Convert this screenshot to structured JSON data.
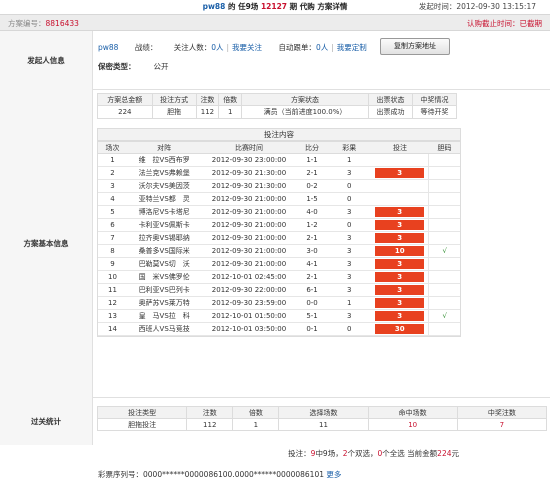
{
  "header": {
    "username": "pw88",
    "title_mid1": "的",
    "lottery": "任9场",
    "issue": "12127",
    "title_tail": "期 代购 方案详情",
    "launch_time_label": "发起时间：",
    "launch_time": "2012-09-30 13:15:17"
  },
  "id_bar": {
    "label": "方案编号：",
    "value": "8816433",
    "buy_label": "认购截止时间：",
    "buy_value": "已截期"
  },
  "initiator": {
    "section_label": "发起人信息",
    "username": "pw88",
    "record_label": "战绩：",
    "follow_label": "关注人数：",
    "follow_count": "0人",
    "follow_link": "我要关注",
    "custom_label": "自动跟单：",
    "custom_count": "0人",
    "custom_link": "我要定制",
    "copy_button": "复制方案地址",
    "privacy_label": "保密类型：",
    "privacy_value": "公开"
  },
  "scheme": {
    "section_label": "方案基本信息",
    "summary_headers": [
      "方案总金额",
      "投注方式",
      "注数",
      "倍数",
      "方案状态",
      "出票状态",
      "中奖情况"
    ],
    "summary_values": [
      "224",
      "胆拖",
      "112",
      "1",
      "满员（当前进度100.0%）",
      "出票成功",
      "等待开奖"
    ],
    "content_title": "投注内容",
    "match_headers": [
      "场次",
      "对阵",
      "比赛时间",
      "比分",
      "彩果",
      "投注",
      "胆码"
    ],
    "matches": [
      {
        "no": "1",
        "vs": "维　拉VS西布罗",
        "time": "2012-09-30 23:00:00",
        "score": "1-1",
        "result": "1",
        "pick": "",
        "dan": ""
      },
      {
        "no": "2",
        "vs": "法兰克VS弗赖堡",
        "time": "2012-09-30 21:30:00",
        "score": "2-1",
        "result": "3",
        "pick": "3",
        "dan": ""
      },
      {
        "no": "3",
        "vs": "沃尔夫VS美因茨",
        "time": "2012-09-30 21:30:00",
        "score": "0-2",
        "result": "0",
        "pick": "",
        "dan": ""
      },
      {
        "no": "4",
        "vs": "亚特兰VS都　灵",
        "time": "2012-09-30 21:00:00",
        "score": "1-5",
        "result": "0",
        "pick": "",
        "dan": ""
      },
      {
        "no": "5",
        "vs": "博洛尼VS卡塔尼",
        "time": "2012-09-30 21:00:00",
        "score": "4-0",
        "result": "3",
        "pick": "3",
        "dan": ""
      },
      {
        "no": "6",
        "vs": "卡利亚VS佩斯卡",
        "time": "2012-09-30 21:00:00",
        "score": "1-2",
        "result": "0",
        "pick": "3",
        "dan": ""
      },
      {
        "no": "7",
        "vs": "拉齐奥VS锡耶纳",
        "time": "2012-09-30 21:00:00",
        "score": "2-1",
        "result": "3",
        "pick": "3",
        "dan": ""
      },
      {
        "no": "8",
        "vs": "桑普多VS国际米",
        "time": "2012-09-30 21:00:00",
        "score": "3-0",
        "result": "3",
        "pick": "10",
        "dan": "√"
      },
      {
        "no": "9",
        "vs": "巴勒莫VS切　沃",
        "time": "2012-09-30 21:00:00",
        "score": "4-1",
        "result": "3",
        "pick": "3",
        "dan": ""
      },
      {
        "no": "10",
        "vs": "国　米VS佛罗伦",
        "time": "2012-10-01 02:45:00",
        "score": "2-1",
        "result": "3",
        "pick": "3",
        "dan": ""
      },
      {
        "no": "11",
        "vs": "巴利亚VS巴列卡",
        "time": "2012-09-30 22:00:00",
        "score": "6-1",
        "result": "3",
        "pick": "3",
        "dan": ""
      },
      {
        "no": "12",
        "vs": "奥萨苏VS莱万特",
        "time": "2012-09-30 23:59:00",
        "score": "0-0",
        "result": "1",
        "pick": "3",
        "dan": ""
      },
      {
        "no": "13",
        "vs": "皇　马VS拉　科",
        "time": "2012-10-01 01:50:00",
        "score": "5-1",
        "result": "3",
        "pick": "3",
        "dan": "√"
      },
      {
        "no": "14",
        "vs": "西班人VS马竞技",
        "time": "2012-10-01 03:50:00",
        "score": "0-1",
        "result": "0",
        "pick": "30",
        "dan": ""
      }
    ],
    "bet_summary": {
      "prefix": "投注：",
      "pass_count": "9",
      "mid1": "中9场，",
      "total_count": "2",
      "mid2": "个双选，",
      "single_count": "0",
      "mid3": "个全选 当前金额",
      "amount": "224",
      "unit": "元"
    },
    "ticket_label": "彩票序列号：",
    "ticket_value": "0000******0000086100.0000******0000086101",
    "ticket_more": "更多"
  },
  "stats": {
    "section_label": "过关统计",
    "headers": [
      "投注类型",
      "注数",
      "倍数",
      "选择场数",
      "命中场数",
      "中奖注数"
    ],
    "values": [
      "胆拖投注",
      "112",
      "1",
      "11",
      "10",
      "7"
    ]
  }
}
